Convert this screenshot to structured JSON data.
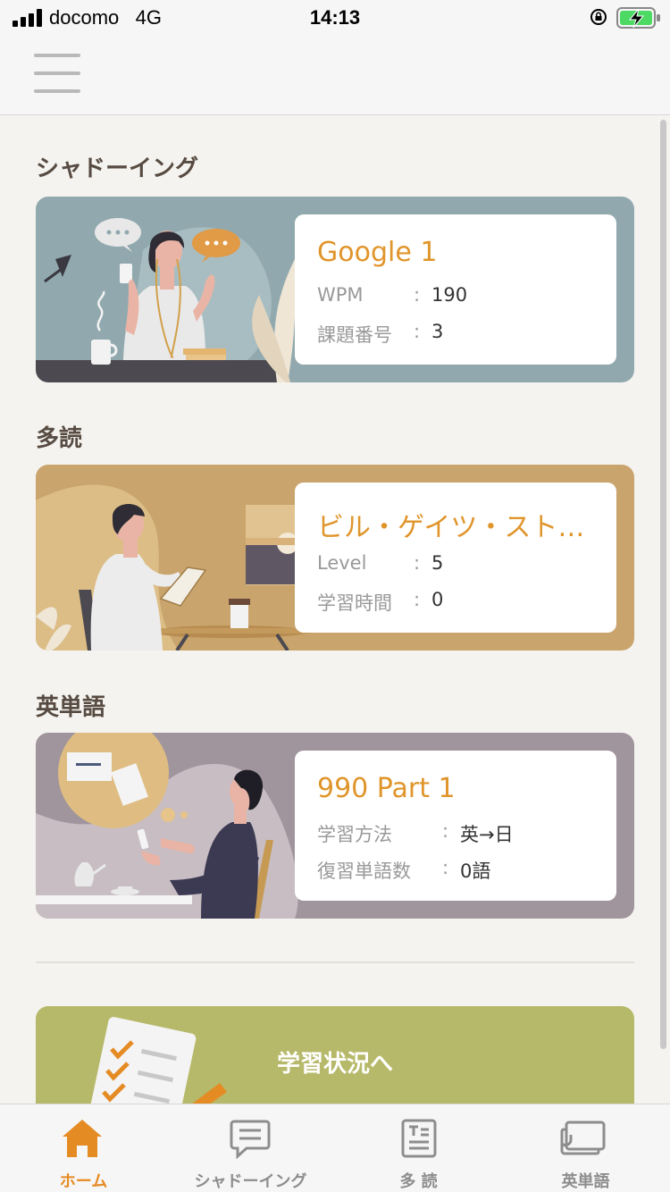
{
  "status_bar": {
    "carrier": "docomo",
    "network": "4G",
    "time": "14:13"
  },
  "sections": {
    "shadowing": {
      "title": "シャドーイング",
      "card_title": "Google 1",
      "rows": [
        {
          "key": "WPM",
          "value": "190"
        },
        {
          "key": "課題番号",
          "value": "3"
        }
      ],
      "colon": ":"
    },
    "extensive_reading": {
      "title": "多読",
      "card_title": "ビル・ゲイツ・スト…",
      "rows": [
        {
          "key": "Level",
          "value": "5"
        },
        {
          "key": "学習時間",
          "value": "0"
        }
      ],
      "colon": ":"
    },
    "vocabulary": {
      "title": "英単語",
      "card_title": "990 Part 1",
      "rows": [
        {
          "key": "学習方法",
          "value": "英→日"
        },
        {
          "key": "復習単語数",
          "value": "0語"
        }
      ],
      "colon": ":"
    }
  },
  "progress_button": {
    "label": "学習状況へ"
  },
  "tab_bar": {
    "active": "home",
    "tabs": [
      {
        "id": "home",
        "label": "ホーム",
        "icon": "home-icon"
      },
      {
        "id": "shadowing",
        "label": "シャドーイング",
        "icon": "chat-icon"
      },
      {
        "id": "reading",
        "label": "多 読",
        "icon": "document-icon"
      },
      {
        "id": "vocabulary",
        "label": "英単語",
        "icon": "flashcard-icon"
      }
    ]
  },
  "colors": {
    "accent": "#e58b24",
    "card_title": "#e0952b",
    "shadowing_card": "#91a9ae",
    "reading_card": "#c9a46d",
    "vocabulary_card": "#a0959c",
    "progress_button": "#b7b96a"
  }
}
